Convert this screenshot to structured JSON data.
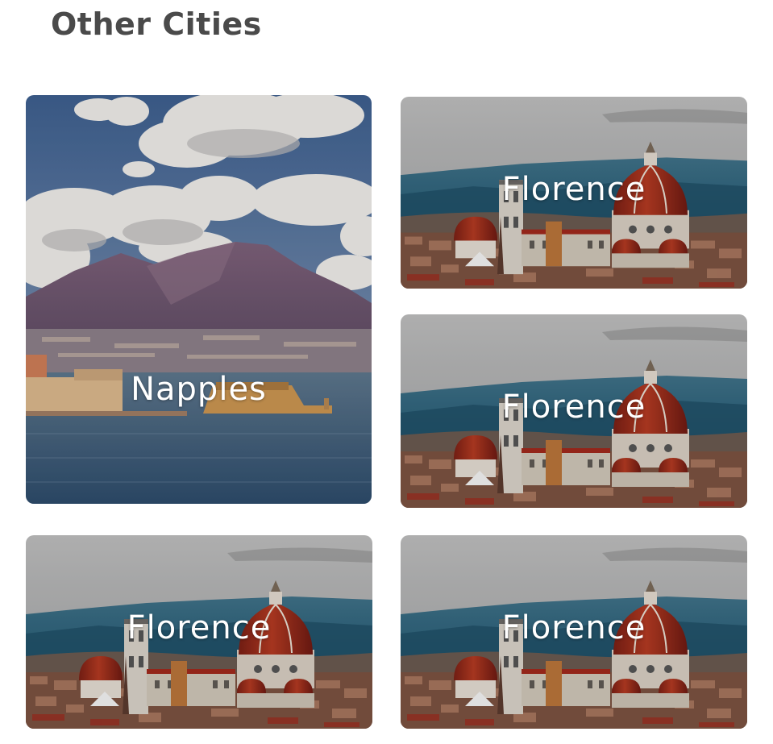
{
  "section": {
    "title": "Other Cities"
  },
  "cities": [
    {
      "label": "Napples",
      "image": "bay-of-naples-vesuvius-photo"
    },
    {
      "label": "Florence",
      "image": "florence-cathedral-skyline-photo"
    },
    {
      "label": "Florence",
      "image": "florence-cathedral-skyline-photo"
    },
    {
      "label": "Florence",
      "image": "florence-cathedral-skyline-photo"
    },
    {
      "label": "Florence",
      "image": "florence-cathedral-skyline-photo"
    }
  ],
  "colors": {
    "title": "#4a4a4a",
    "label": "#ffffff"
  }
}
